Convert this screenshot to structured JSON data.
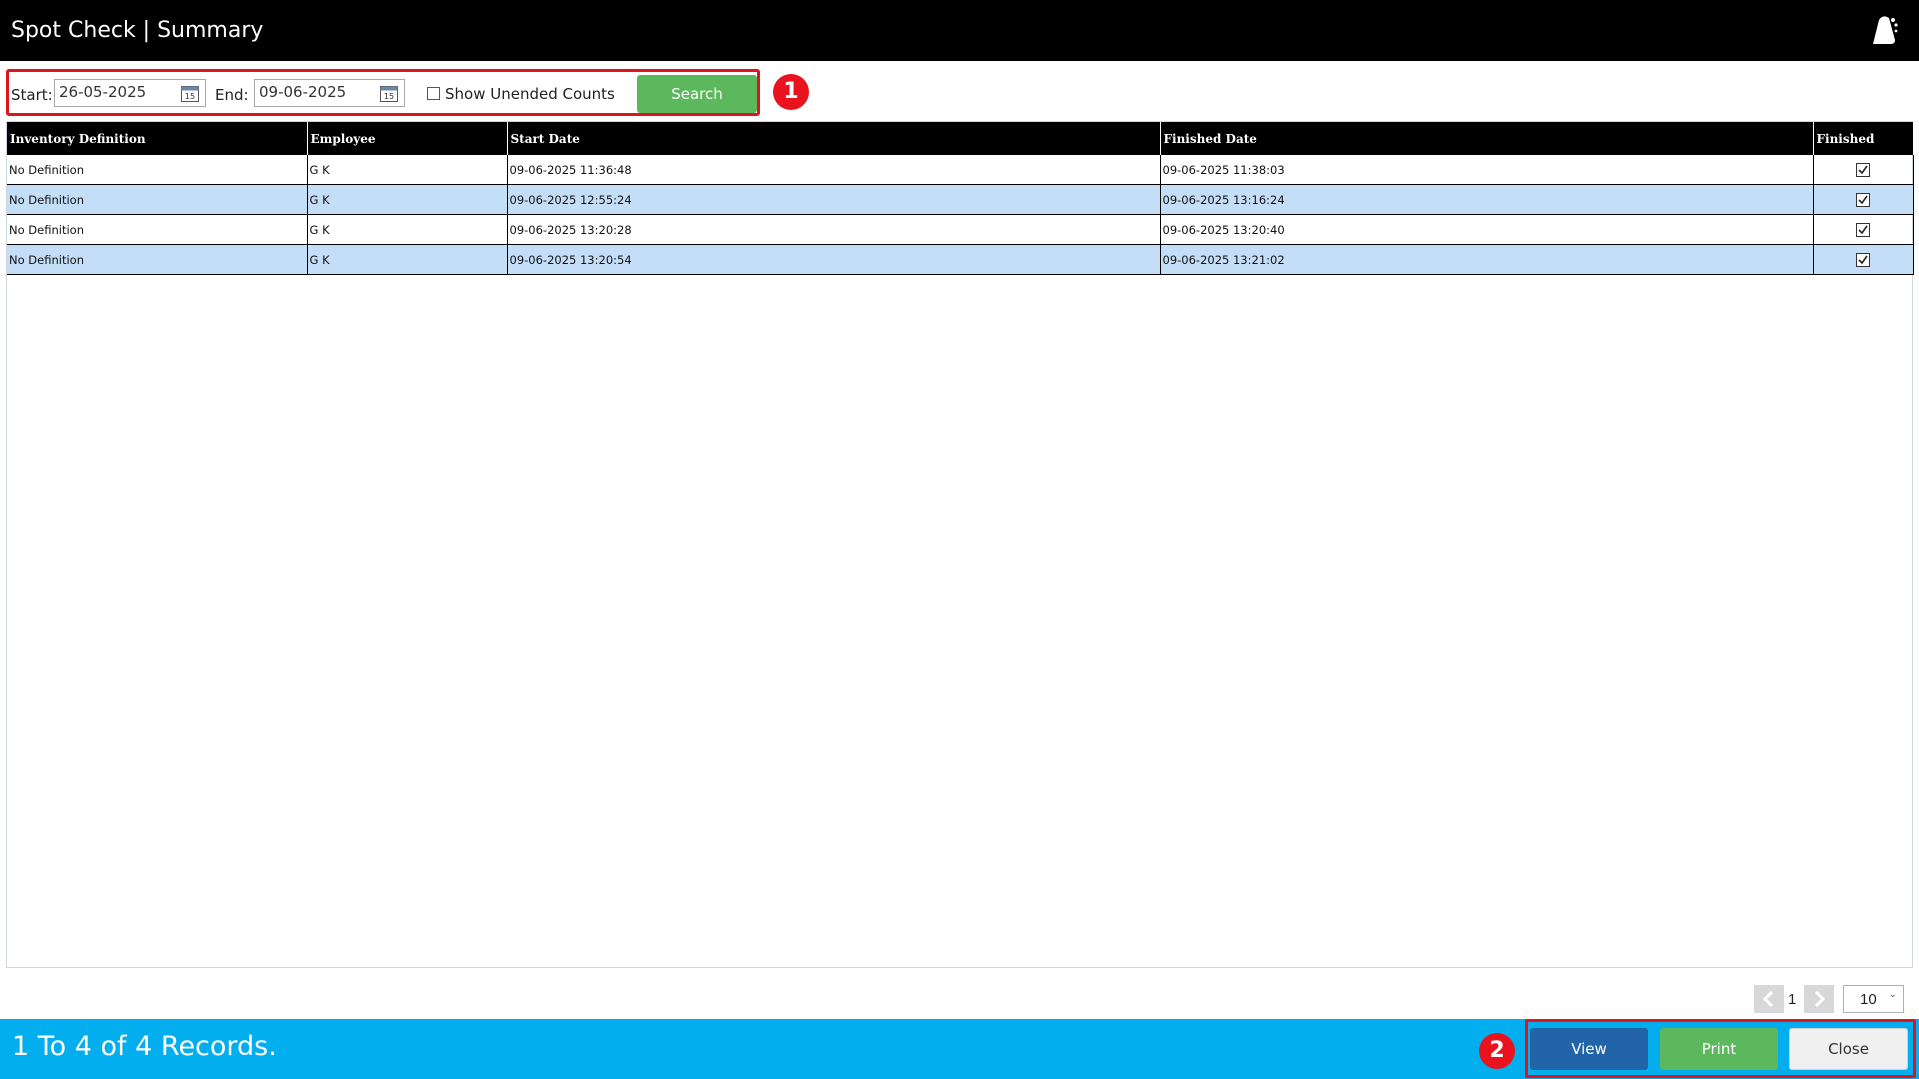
{
  "window": {
    "title": "Spot Check | Summary",
    "logo_icon": "bell-logo-icon"
  },
  "filters": {
    "start_label": "Start:",
    "start_value": "26-05-2025",
    "end_label": "End:",
    "end_value": "09-06-2025",
    "show_unended_label": "Show Unended Counts",
    "show_unended_checked": false,
    "search_label": "Search"
  },
  "callouts": {
    "one": "1",
    "two": "2"
  },
  "table": {
    "columns": [
      "Inventory Definition",
      "Employee",
      "Start Date",
      "Finished Date",
      "Finished"
    ],
    "rows": [
      {
        "definition": "No Definition",
        "employee": "G K",
        "start": "09-06-2025 11:36:48",
        "finished_date": "09-06-2025 11:38:03",
        "finished": true
      },
      {
        "definition": "No Definition",
        "employee": "G K",
        "start": "09-06-2025 12:55:24",
        "finished_date": "09-06-2025 13:16:24",
        "finished": true
      },
      {
        "definition": "No Definition",
        "employee": "G K",
        "start": "09-06-2025 13:20:28",
        "finished_date": "09-06-2025 13:20:40",
        "finished": true
      },
      {
        "definition": "No Definition",
        "employee": "G K",
        "start": "09-06-2025 13:20:54",
        "finished_date": "09-06-2025 13:21:02",
        "finished": true
      }
    ]
  },
  "pager": {
    "current_page": "1",
    "page_size": "10"
  },
  "status": {
    "records_text": "1 To 4 of 4 Records."
  },
  "actions": {
    "view_label": "View",
    "print_label": "Print",
    "close_label": "Close"
  },
  "colors": {
    "title_bar": "#000000",
    "status_bar": "#03aeef",
    "search_button": "#5cb85c",
    "view_button": "#2165a8",
    "print_button": "#5cb85c",
    "alt_row": "#c5def8",
    "callout_red": "#e0141e"
  }
}
